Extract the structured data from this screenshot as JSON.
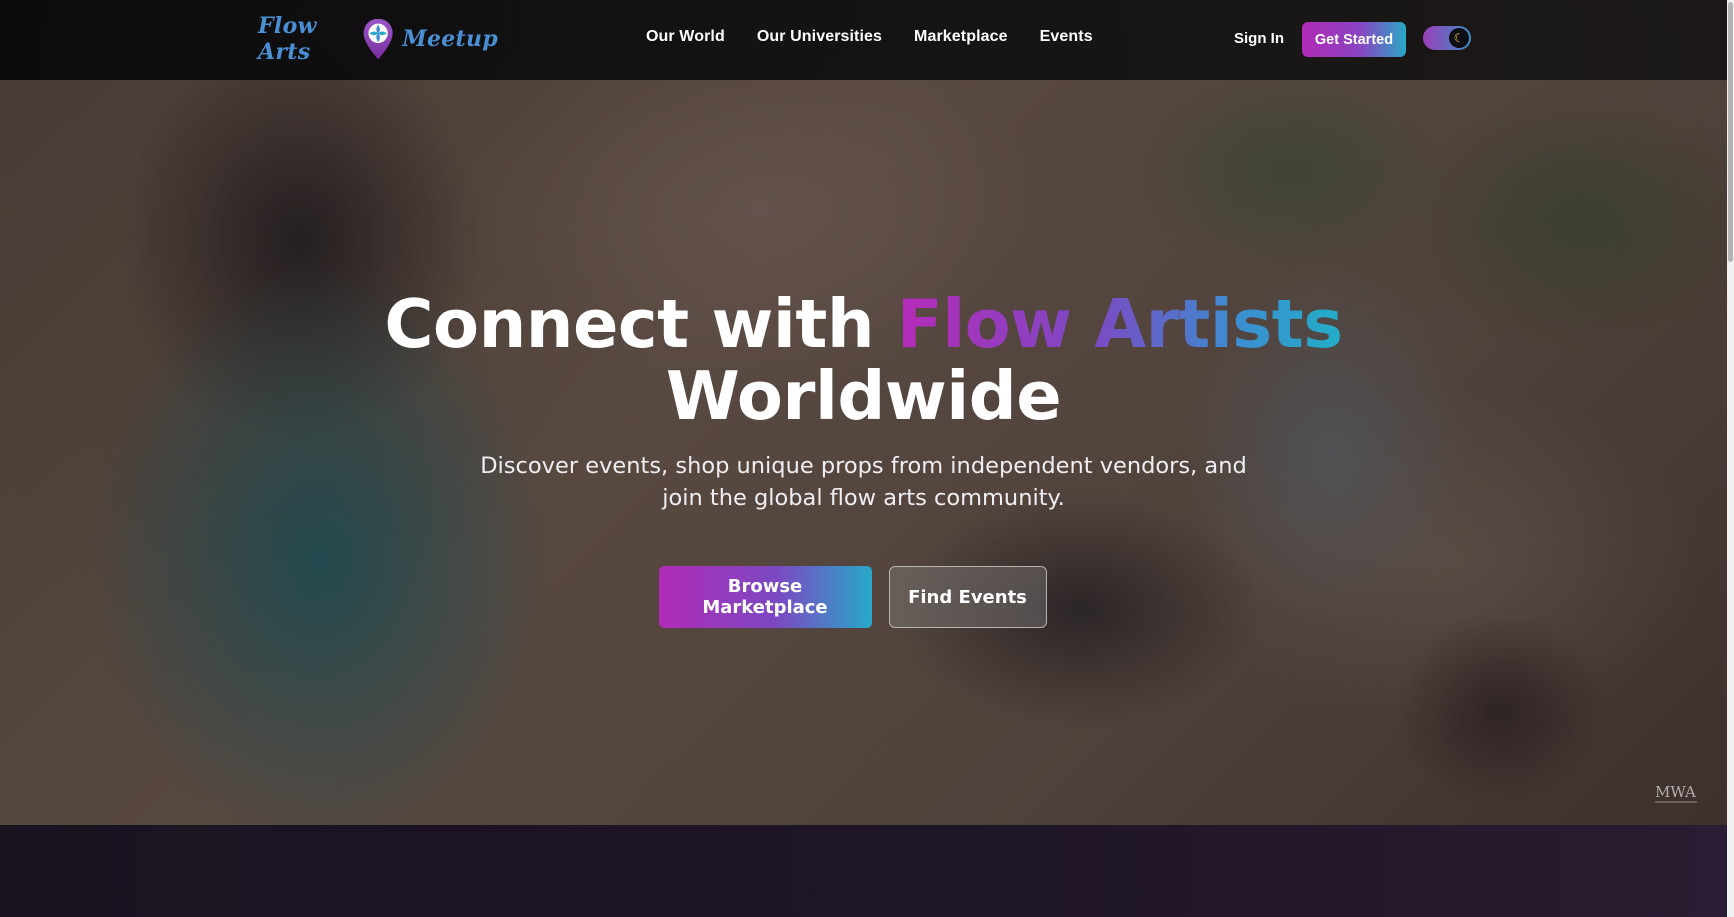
{
  "navbar": {
    "logo": {
      "text_left": "Flow Arts",
      "text_right": "Meetup"
    },
    "links": [
      "Our World",
      "Our Universities",
      "Marketplace",
      "Events"
    ],
    "sign_in": "Sign In",
    "get_started": "Get Started",
    "theme_toggle_icon": "moon-icon"
  },
  "hero": {
    "title_part1": "Connect with ",
    "title_accent": "Flow Artists",
    "title_part2": "Worldwide",
    "subtitle": "Discover events, shop unique props from independent vendors, and join the global flow arts community.",
    "primary_button": "Browse Marketplace",
    "secondary_button": "Find Events",
    "watermark": "MWA"
  },
  "colors": {
    "brand_magenta": "#b02bb5",
    "brand_purple": "#7c48c2",
    "brand_cyan": "#27a9c8",
    "logo_blue": "#4a8fd4",
    "page_dark": "#1c1420"
  }
}
